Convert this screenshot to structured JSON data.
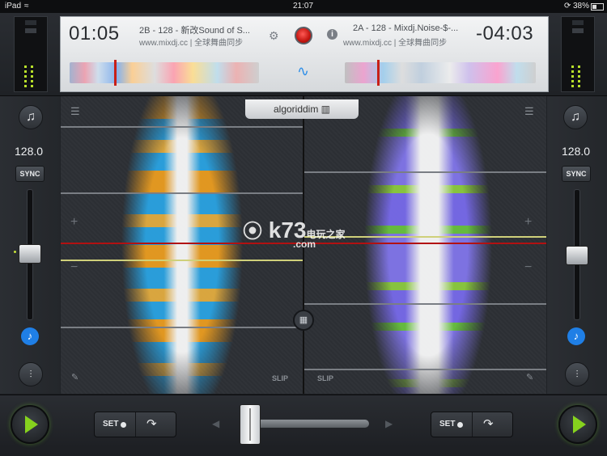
{
  "status": {
    "device": "iPad",
    "time": "21:07",
    "battery": "38%"
  },
  "deck_a": {
    "elapsed": "01:05",
    "title": "2B - 128 - 新改Sound of S...",
    "source": "www.mixdj.cc | 全球舞曲同步",
    "bpm": "128.0",
    "sync_label": "SYNC",
    "set_label": "SET",
    "slip_label": "SLIP",
    "colors": {
      "wave": "#f0a020",
      "core": "#ffffff",
      "accent": "#2aa7e8"
    }
  },
  "deck_b": {
    "remaining": "-04:03",
    "title": "2A - 128 - Mixdj.Noise-$-...",
    "source": "www.mixdj.cc | 全球舞曲同步",
    "bpm": "128.0",
    "sync_label": "SYNC",
    "set_label": "SET",
    "slip_label": "SLIP",
    "colors": {
      "wave": "#7a6cf0",
      "core": "#ffffff",
      "accent": "#7ad040"
    }
  },
  "center": {
    "logo": "algoriddim",
    "grid_icon": "grid-icon",
    "record_color": "#d21b14"
  },
  "icons": [
    "gear-icon",
    "info-icon",
    "record-button",
    "waveform-icon",
    "music-add-icon",
    "music-note-icon",
    "eq-icon",
    "loop-icon",
    "play-icon",
    "pencil-icon",
    "list-icon"
  ],
  "watermark": {
    "text": "k73",
    "sub": "电玩之家",
    "domain": ".com"
  }
}
